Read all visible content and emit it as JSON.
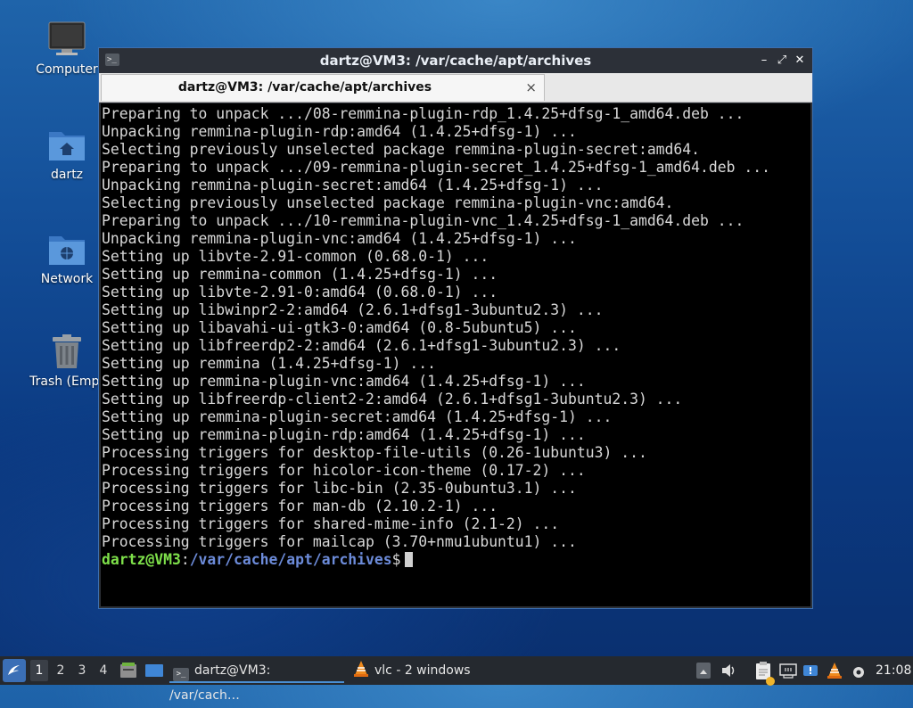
{
  "desktop": {
    "icons": [
      {
        "label": "Computer",
        "icon": "computer-icon"
      },
      {
        "label": "dartz",
        "icon": "home-folder-icon"
      },
      {
        "label": "Network",
        "icon": "network-folder-icon"
      },
      {
        "label": "Trash (Empt",
        "icon": "trash-icon"
      }
    ]
  },
  "window": {
    "title": "dartz@VM3: /var/cache/apt/archives",
    "tab_label": "dartz@VM3: /var/cache/apt/archives",
    "tab_close": "×",
    "buttons": {
      "minimize": "–",
      "maximize": "⤢",
      "close": "✕"
    }
  },
  "terminal": {
    "lines": [
      "Preparing to unpack .../08-remmina-plugin-rdp_1.4.25+dfsg-1_amd64.deb ...",
      "Unpacking remmina-plugin-rdp:amd64 (1.4.25+dfsg-1) ...",
      "Selecting previously unselected package remmina-plugin-secret:amd64.",
      "Preparing to unpack .../09-remmina-plugin-secret_1.4.25+dfsg-1_amd64.deb ...",
      "Unpacking remmina-plugin-secret:amd64 (1.4.25+dfsg-1) ...",
      "Selecting previously unselected package remmina-plugin-vnc:amd64.",
      "Preparing to unpack .../10-remmina-plugin-vnc_1.4.25+dfsg-1_amd64.deb ...",
      "Unpacking remmina-plugin-vnc:amd64 (1.4.25+dfsg-1) ...",
      "Setting up libvte-2.91-common (0.68.0-1) ...",
      "Setting up remmina-common (1.4.25+dfsg-1) ...",
      "Setting up libvte-2.91-0:amd64 (0.68.0-1) ...",
      "Setting up libwinpr2-2:amd64 (2.6.1+dfsg1-3ubuntu2.3) ...",
      "Setting up libavahi-ui-gtk3-0:amd64 (0.8-5ubuntu5) ...",
      "Setting up libfreerdp2-2:amd64 (2.6.1+dfsg1-3ubuntu2.3) ...",
      "Setting up remmina (1.4.25+dfsg-1) ...",
      "Setting up remmina-plugin-vnc:amd64 (1.4.25+dfsg-1) ...",
      "Setting up libfreerdp-client2-2:amd64 (2.6.1+dfsg1-3ubuntu2.3) ...",
      "Setting up remmina-plugin-secret:amd64 (1.4.25+dfsg-1) ...",
      "Setting up remmina-plugin-rdp:amd64 (1.4.25+dfsg-1) ...",
      "Processing triggers for desktop-file-utils (0.26-1ubuntu3) ...",
      "Processing triggers for hicolor-icon-theme (0.17-2) ...",
      "Processing triggers for libc-bin (2.35-0ubuntu3.1) ...",
      "Processing triggers for man-db (2.10.2-1) ...",
      "Processing triggers for shared-mime-info (2.1-2) ...",
      "Processing triggers for mailcap (3.70+nmu1ubuntu1) ..."
    ],
    "prompt_user": "dartz@VM3",
    "prompt_sep": ":",
    "prompt_path": "/var/cache/apt/archives",
    "prompt_end": "$"
  },
  "taskbar": {
    "menu_icon": "lxqt-menu-icon",
    "workspaces": [
      "1",
      "2",
      "3",
      "4"
    ],
    "active_workspace": "1",
    "tasks": [
      {
        "label": "dartz@VM3: /var/cach…",
        "icon": "terminal-icon",
        "active": true
      },
      {
        "label": "vlc - 2 windows",
        "icon": "vlc-icon",
        "active": false
      }
    ],
    "clock": "21:08"
  }
}
